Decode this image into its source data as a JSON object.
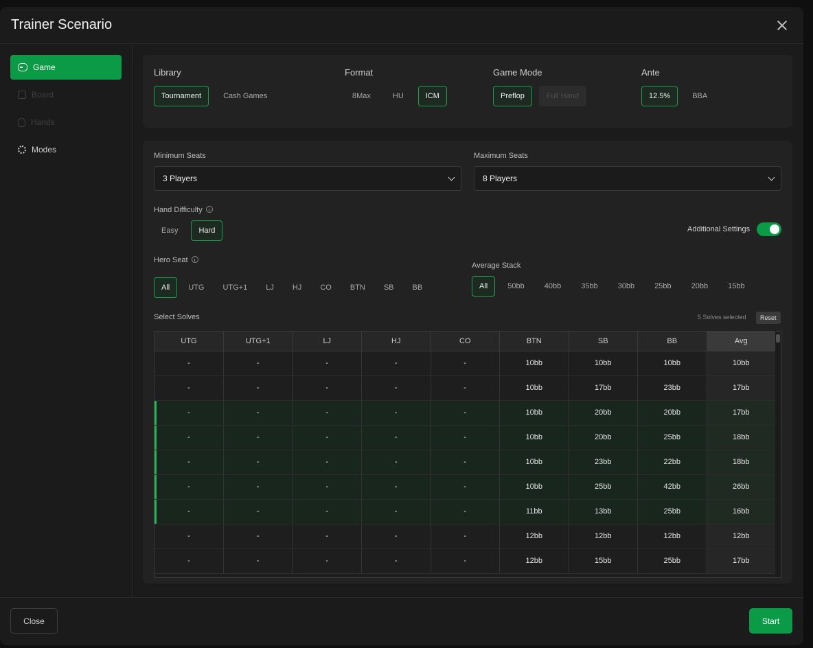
{
  "window": {
    "title": "Trainer Scenario"
  },
  "sidebar": {
    "items": [
      {
        "label": "Game",
        "icon": "gamepad-icon"
      },
      {
        "label": "Board",
        "icon": "board-icon"
      },
      {
        "label": "Hands",
        "icon": "hand-icon"
      },
      {
        "label": "Modes",
        "icon": "gear-icon"
      }
    ]
  },
  "library": {
    "label": "Library",
    "options": [
      "Tournament",
      "Cash Games"
    ],
    "selected": "Tournament"
  },
  "format": {
    "label": "Format",
    "options": [
      "8Max",
      "HU",
      "ICM"
    ],
    "selected": "ICM"
  },
  "game_mode": {
    "label": "Game Mode",
    "options": [
      "Preflop",
      "Full Hand"
    ],
    "selected": "Preflop"
  },
  "ante": {
    "label": "Ante",
    "options": [
      "12.5%",
      "BBA"
    ],
    "selected": "12.5%"
  },
  "min_seats": {
    "label": "Minimum Seats",
    "value": "3 Players"
  },
  "max_seats": {
    "label": "Maximum Seats",
    "value": "8 Players"
  },
  "hand_difficulty": {
    "label": "Hand Difficulty",
    "options": [
      "Easy",
      "Hard"
    ],
    "selected": "Hard"
  },
  "additional_settings": {
    "label": "Additional Settings",
    "enabled": true
  },
  "hero_seat": {
    "label": "Hero Seat",
    "options": [
      "All",
      "UTG",
      "UTG+1",
      "LJ",
      "HJ",
      "CO",
      "BTN",
      "SB",
      "BB"
    ],
    "selected": "All"
  },
  "average_stack": {
    "label": "Average Stack",
    "options": [
      "All",
      "50bb",
      "40bb",
      "35bb",
      "30bb",
      "25bb",
      "20bb",
      "15bb"
    ],
    "selected": "All"
  },
  "solves": {
    "label": "Select Solves",
    "count_text": "5 Solves selected",
    "reset_label": "Reset",
    "columns": [
      "UTG",
      "UTG+1",
      "LJ",
      "HJ",
      "CO",
      "BTN",
      "SB",
      "BB",
      "Avg"
    ],
    "rows": [
      {
        "selected": false,
        "cells": [
          "-",
          "-",
          "-",
          "-",
          "-",
          "10bb",
          "10bb",
          "10bb",
          "10bb"
        ]
      },
      {
        "selected": false,
        "cells": [
          "-",
          "-",
          "-",
          "-",
          "-",
          "10bb",
          "17bb",
          "23bb",
          "17bb"
        ]
      },
      {
        "selected": true,
        "cells": [
          "-",
          "-",
          "-",
          "-",
          "-",
          "10bb",
          "20bb",
          "20bb",
          "17bb"
        ]
      },
      {
        "selected": true,
        "cells": [
          "-",
          "-",
          "-",
          "-",
          "-",
          "10bb",
          "20bb",
          "25bb",
          "18bb"
        ]
      },
      {
        "selected": true,
        "cells": [
          "-",
          "-",
          "-",
          "-",
          "-",
          "10bb",
          "23bb",
          "22bb",
          "18bb"
        ]
      },
      {
        "selected": true,
        "cells": [
          "-",
          "-",
          "-",
          "-",
          "-",
          "10bb",
          "25bb",
          "42bb",
          "26bb"
        ]
      },
      {
        "selected": true,
        "cells": [
          "-",
          "-",
          "-",
          "-",
          "-",
          "11bb",
          "13bb",
          "25bb",
          "16bb"
        ]
      },
      {
        "selected": false,
        "cells": [
          "-",
          "-",
          "-",
          "-",
          "-",
          "12bb",
          "12bb",
          "12bb",
          "12bb"
        ]
      },
      {
        "selected": false,
        "cells": [
          "-",
          "-",
          "-",
          "-",
          "-",
          "12bb",
          "15bb",
          "25bb",
          "17bb"
        ]
      }
    ]
  },
  "footer": {
    "close_label": "Close",
    "start_label": "Start"
  },
  "colors": {
    "accent": "#0b9a46",
    "selected_border": "#1f9c50",
    "background": "#1b1b1b"
  }
}
